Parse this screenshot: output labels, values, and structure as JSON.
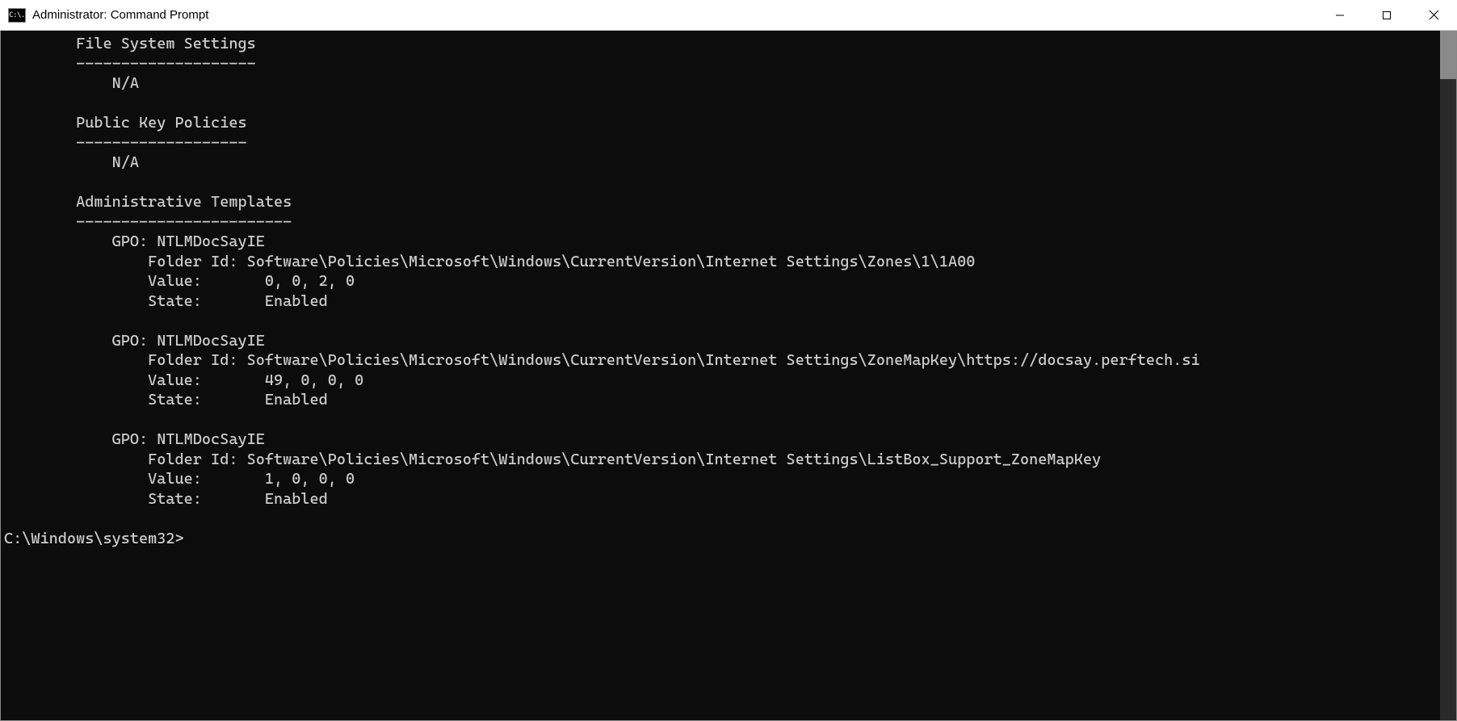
{
  "window": {
    "title": "Administrator: Command Prompt",
    "icon_label": "C:\\."
  },
  "terminal": {
    "lines": [
      "        File System Settings",
      "        --------------------",
      "            N/A",
      "",
      "        Public Key Policies",
      "        -------------------",
      "            N/A",
      "",
      "        Administrative Templates",
      "        ------------------------",
      "            GPO: NTLMDocSayIE",
      "                Folder Id: Software\\Policies\\Microsoft\\Windows\\CurrentVersion\\Internet Settings\\Zones\\1\\1A00",
      "                Value:       0, 0, 2, 0",
      "                State:       Enabled",
      "",
      "            GPO: NTLMDocSayIE",
      "                Folder Id: Software\\Policies\\Microsoft\\Windows\\CurrentVersion\\Internet Settings\\ZoneMapKey\\https://docsay.perftech.si",
      "                Value:       49, 0, 0, 0",
      "                State:       Enabled",
      "",
      "            GPO: NTLMDocSayIE",
      "                Folder Id: Software\\Policies\\Microsoft\\Windows\\CurrentVersion\\Internet Settings\\ListBox_Support_ZoneMapKey",
      "                Value:       1, 0, 0, 0",
      "                State:       Enabled",
      "",
      "C:\\Windows\\system32>"
    ]
  }
}
